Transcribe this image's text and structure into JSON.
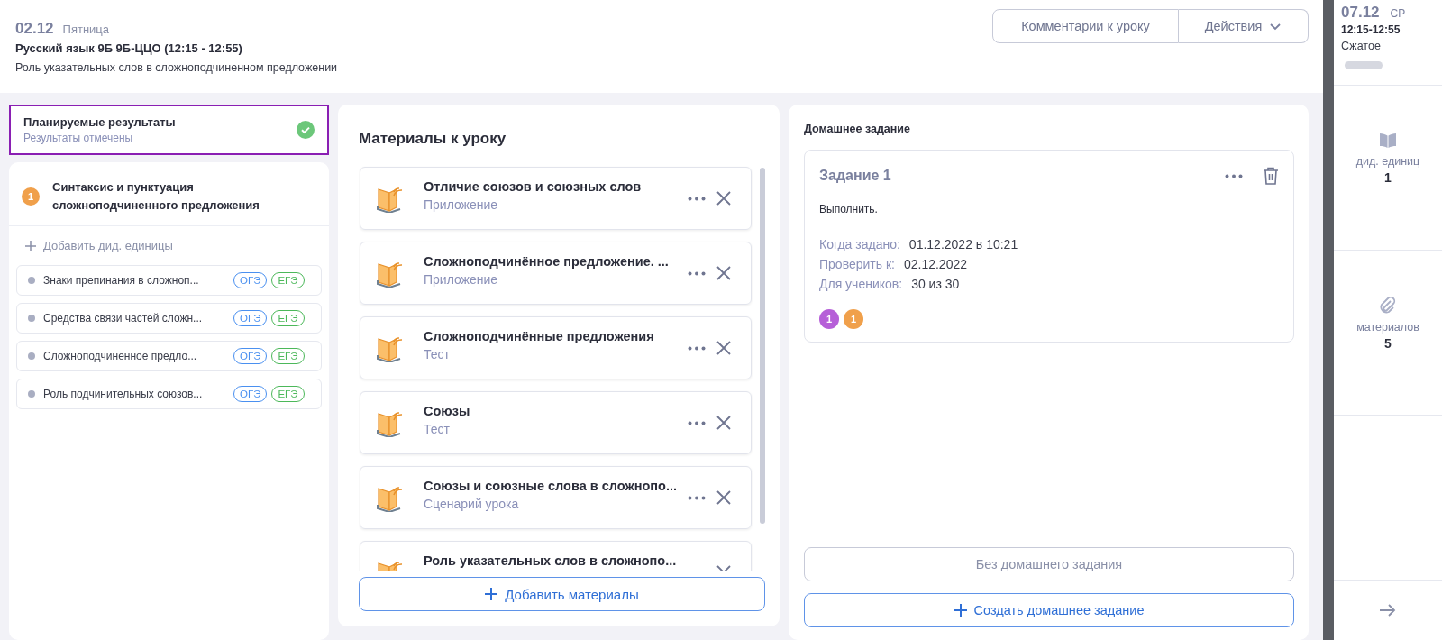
{
  "header": {
    "date": "02.12",
    "weekday": "Пятница",
    "lesson": "Русский язык 9Б 9Б-ЦЦО (12:15 - 12:55)",
    "topic": "Роль указательных слов в сложноподчиненном предложении",
    "buttons": [
      "Комментарии к уроку",
      "Действия"
    ]
  },
  "planned_results": {
    "title": "Планируемые результаты",
    "status": "Результаты отмечены",
    "done": true
  },
  "unit": {
    "number": "1",
    "title": "Синтаксис и пунктуация сложноподчиненного предложения",
    "add_label": "Добавить дид. единицы",
    "items": [
      {
        "text": "Знаки препинания в сложноп...",
        "tags": [
          {
            "label": "ОГЭ",
            "color": "#4a90f0"
          },
          {
            "label": "ЕГЭ",
            "color": "#4cb85a"
          }
        ]
      },
      {
        "text": "Средства связи частей сложн...",
        "tags": [
          {
            "label": "ОГЭ",
            "color": "#4a90f0"
          },
          {
            "label": "ЕГЭ",
            "color": "#4cb85a"
          }
        ]
      },
      {
        "text": "Сложноподчиненное предло...",
        "tags": [
          {
            "label": "ОГЭ",
            "color": "#4a90f0"
          },
          {
            "label": "ЕГЭ",
            "color": "#4cb85a"
          }
        ]
      },
      {
        "text": "Роль подчинительных союзов...",
        "tags": [
          {
            "label": "ОГЭ",
            "color": "#4a90f0"
          },
          {
            "label": "ЕГЭ",
            "color": "#4cb85a"
          }
        ]
      }
    ]
  },
  "materials": {
    "title": "Материалы к уроку",
    "add_label": "Добавить материалы",
    "items": [
      {
        "title": "Отличие союзов и союзных слов",
        "type": "Приложение"
      },
      {
        "title": "Сложноподчинённое предложение. ...",
        "type": "Приложение"
      },
      {
        "title": "Сложноподчинённые предложения",
        "type": "Тест"
      },
      {
        "title": "Союзы",
        "type": "Тест"
      },
      {
        "title": "Союзы и союзные слова в сложнопо...",
        "type": "Сценарий урока"
      },
      {
        "title": "Роль указательных слов в сложнопо..."
      }
    ]
  },
  "homework": {
    "title": "Домашнее задание",
    "task": {
      "title": "Задание 1",
      "text": "Выполнить.",
      "fields": [
        {
          "label": "Когда задано:",
          "value": "01.12.2022 в 10:21"
        },
        {
          "label": "Проверить к:",
          "value": "02.12.2022"
        },
        {
          "label": "Для учеников:",
          "value": "30 из 30"
        }
      ],
      "badges": [
        {
          "label": "1",
          "color": "#b65fd8"
        },
        {
          "label": "1",
          "color": "#f0a04b"
        }
      ]
    },
    "buttons": [
      {
        "label": "Без домашнего задания",
        "kind": "plain"
      },
      {
        "label": "Создать домашнее задание",
        "kind": "add"
      }
    ]
  },
  "side_panel": {
    "date": "07.12",
    "weekday": "СР",
    "time": "12:15-12:55",
    "mode": "Сжатое",
    "stats": [
      {
        "kind": "units",
        "label": "дид. единиц",
        "value": "1"
      },
      {
        "kind": "materials",
        "label": "материалов",
        "value": "5"
      }
    ]
  }
}
